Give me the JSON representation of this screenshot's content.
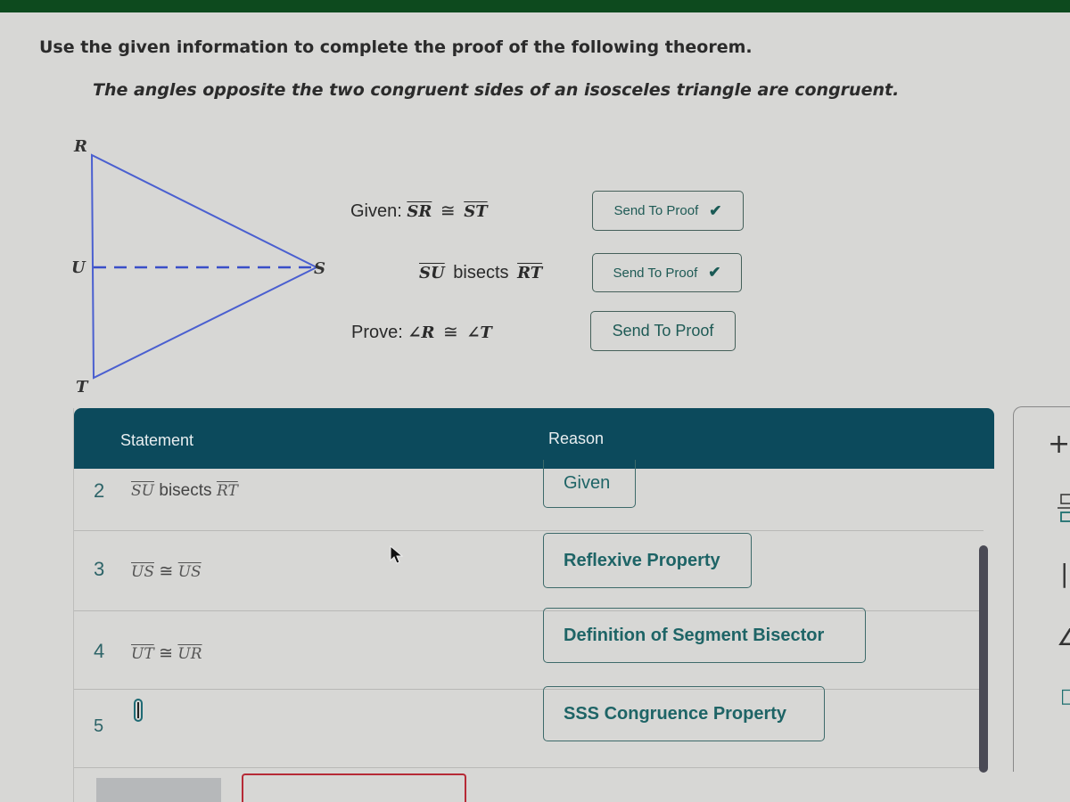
{
  "instructions": "Use the given information to complete the proof of the following theorem.",
  "theorem": "The angles opposite the two congruent sides of an isosceles triangle are congruent.",
  "diagram": {
    "vertices": {
      "R": "R",
      "S": "S",
      "T": "T",
      "U": "U"
    },
    "line_color": "#4a5fd0"
  },
  "given": {
    "label": "Given:",
    "statement1": {
      "left": "SR",
      "symbol": "≅",
      "right": "ST"
    },
    "statement2": {
      "left": "SU",
      "word": "bisects",
      "right": "RT"
    },
    "prove_label": "Prove:",
    "prove": {
      "left": "∠R",
      "symbol": "≅",
      "right": "∠T"
    },
    "buttons": [
      {
        "label": "Send To Proof",
        "sent": true,
        "check": "✔"
      },
      {
        "label": "Send To Proof",
        "sent": true,
        "check": "✔"
      },
      {
        "label": "Send To Proof",
        "sent": false,
        "check": ""
      }
    ]
  },
  "proof": {
    "headers": {
      "statement": "Statement",
      "reason": "Reason"
    },
    "rows": [
      {
        "num": "2",
        "left": "SU",
        "word": "bisects",
        "symbol": "",
        "right": "RT",
        "reason": "Given"
      },
      {
        "num": "3",
        "left": "US",
        "word": "",
        "symbol": "≅",
        "right": "US",
        "reason": "Reflexive Property"
      },
      {
        "num": "4",
        "left": "UT",
        "word": "",
        "symbol": "≅",
        "right": "UR",
        "reason": "Definition of Segment Bisector"
      },
      {
        "num": "5",
        "left": "",
        "word": "",
        "symbol": "",
        "right": "",
        "reason": "SSS Congruence Property"
      }
    ]
  },
  "toolbar": {
    "plus": "+",
    "fraction": "fraction",
    "parallel": "||",
    "angle": "∠",
    "box": "□"
  },
  "colors": {
    "header_bg": "#0c4a5c",
    "accent": "#1e6466",
    "triangle": "#4a5fd0"
  }
}
